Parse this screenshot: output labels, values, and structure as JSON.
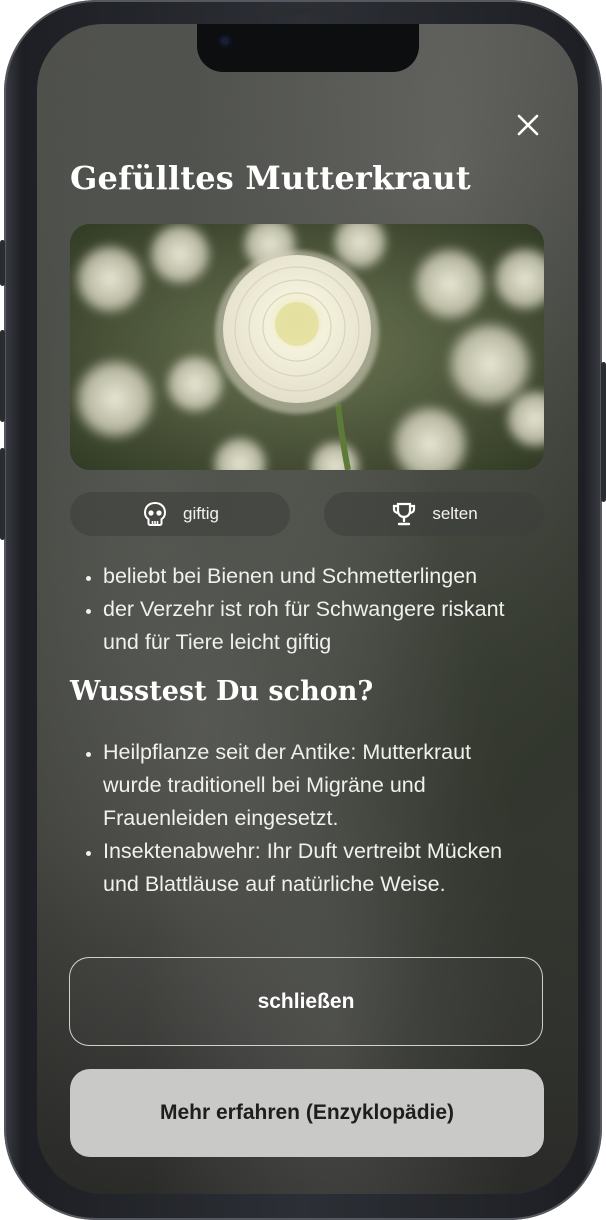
{
  "modal": {
    "title": "Gefülltes Mutterkraut",
    "close_icon": "close-icon",
    "image_subject": "flower-photo"
  },
  "badges": [
    {
      "icon": "skull-icon",
      "label": "giftig"
    },
    {
      "icon": "trophy-icon",
      "label": "selten"
    }
  ],
  "facts": [
    "beliebt bei Bienen und Schmetterlingen",
    "der Verzehr ist roh für Schwangere riskant und für Tiere leicht giftig"
  ],
  "did_you_know": {
    "title": "Wusstest Du schon?",
    "items": [
      "Heilpflanze seit der Antike: Mutterkraut wurde traditionell bei Migräne und Frauenleiden eingesetzt.",
      "Insektenabwehr: Ihr Duft vertreibt Mücken und Blattläuse auf natürliche Weise."
    ]
  },
  "buttons": {
    "close_label": "schließen",
    "more_label": "Mehr erfahren (Enzyklopädie)"
  },
  "colors": {
    "primary_button_bg": "#c9cac7",
    "text": "#ffffff"
  }
}
